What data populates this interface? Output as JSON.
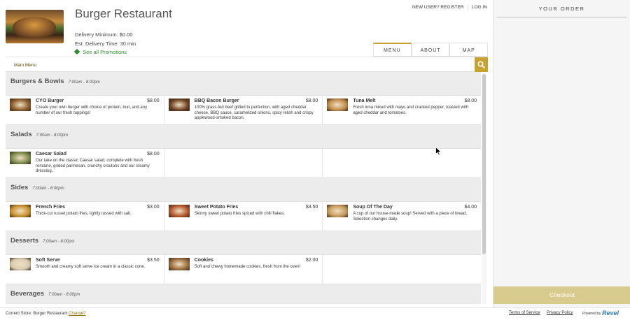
{
  "header": {
    "restaurant_name": "Burger Restaurant",
    "delivery_minimum": "Delivery Minimum: $0.00",
    "delivery_time": "Est. Delivery Time: 30 min",
    "promotions": "See all Promotions",
    "auth": {
      "register": "NEW USER? REGISTER",
      "separator": "|",
      "login": "LOG IN"
    }
  },
  "tabs": [
    {
      "label": "MENU",
      "active": true
    },
    {
      "label": "ABOUT",
      "active": false
    },
    {
      "label": "MAP",
      "active": false
    }
  ],
  "menu_bar": {
    "label": "Main Menu",
    "search_icon": "search-icon"
  },
  "categories": [
    {
      "name": "Burgers & Bowls",
      "hours": "7:00am - 8:00pm",
      "items": [
        {
          "name": "CYO Burger",
          "price": "$8.00",
          "desc": "Create your own burger with choice of protein, bun, and any number of our fresh toppings!",
          "thumb": "#8a5a2a"
        },
        {
          "name": "BBQ Bacon Burger",
          "price": "$8.00",
          "desc": "100% grass-fed beef grilled to perfection, with aged cheddar cheese, BBQ sauce, caramelized onions, spicy relish and crispy applewood-smoked bacon.",
          "thumb": "#6b3f1f"
        },
        {
          "name": "Tuna Melt",
          "price": "$8.00",
          "desc": "Fresh tuna mixed with mayo and cracked pepper, toasted with aged cheddar and tomatoes.",
          "thumb": "#c08a4a"
        }
      ]
    },
    {
      "name": "Salads",
      "hours": "7:00am - 8:00pm",
      "items": [
        {
          "name": "Caesar Salad",
          "price": "$8.00",
          "desc": "Our take on the classic Caesar salad, complete with fresh romaine, grated parmesan, crunchy croutons and our creamy dressing.",
          "thumb": "#7a8a4a"
        }
      ]
    },
    {
      "name": "Sides",
      "hours": "7:00am - 8:00pm",
      "items": [
        {
          "name": "French Fries",
          "price": "$3.00",
          "desc": "Thick-cut russet potato fries, lightly tossed with salt.",
          "thumb": "#c8902e"
        },
        {
          "name": "Sweet Potato Fries",
          "price": "$3.50",
          "desc": "Skinny sweet potato fries spiced with chili flakes.",
          "thumb": "#b2552a"
        },
        {
          "name": "Soup Of The Day",
          "price": "$4.00",
          "desc": "A cup of our house-made soup! Served with a piece of bread. Selection changes daily.",
          "thumb": "#c79a5a"
        }
      ]
    },
    {
      "name": "Desserts",
      "hours": "7:00am - 8:00pm",
      "items": [
        {
          "name": "Soft Serve",
          "price": "$3.50",
          "desc": "Smooth and creamy soft serve ice cream in a classic cone.",
          "thumb": "#d9cbb0"
        },
        {
          "name": "Cookies",
          "price": "$2.00",
          "desc": "Soft and chewy homemade cookies, fresh from the oven!",
          "thumb": "#9a6a3a"
        }
      ]
    },
    {
      "name": "Beverages",
      "hours": "7:00am - 8:00pm",
      "items": []
    }
  ],
  "order_panel": {
    "title": "YOUR ORDER",
    "checkout_label": "Checkout"
  },
  "footer": {
    "current_store_label": "Current Store: Burger Restaurant",
    "change_link": "Change?",
    "terms": "Terms of Service",
    "privacy": "Privacy Policy",
    "powered_by": "Powered by",
    "brand": "Revel"
  },
  "colors": {
    "accent": "#c7a233",
    "checkout": "#d8cb8d",
    "promo_green": "#2e8b2e",
    "category_bg": "#ececec"
  }
}
